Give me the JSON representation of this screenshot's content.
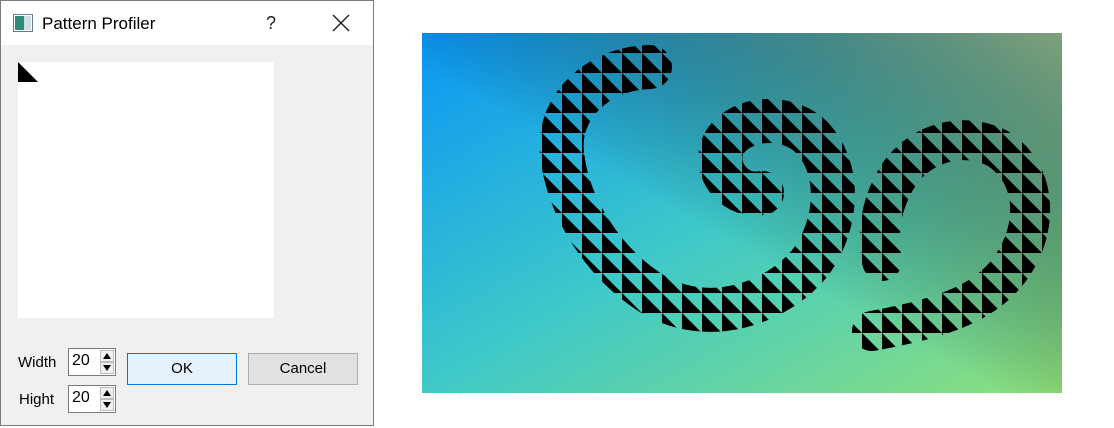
{
  "window": {
    "title": "Pattern Profiler",
    "help_label": "?",
    "icons": {
      "app": "app-window-icon",
      "close": "close-icon"
    }
  },
  "controls": {
    "width_label": "Width",
    "width_value": "20",
    "height_label": "Hight",
    "height_value": "20",
    "ok_label": "OK",
    "cancel_label": "Cancel"
  },
  "canvas": {
    "gradient_colors": [
      "#0a96f5",
      "#14e6e6",
      "#8fe07a",
      "#8b9a6e"
    ],
    "pattern_color": "#000000",
    "pattern_cell": 20
  }
}
